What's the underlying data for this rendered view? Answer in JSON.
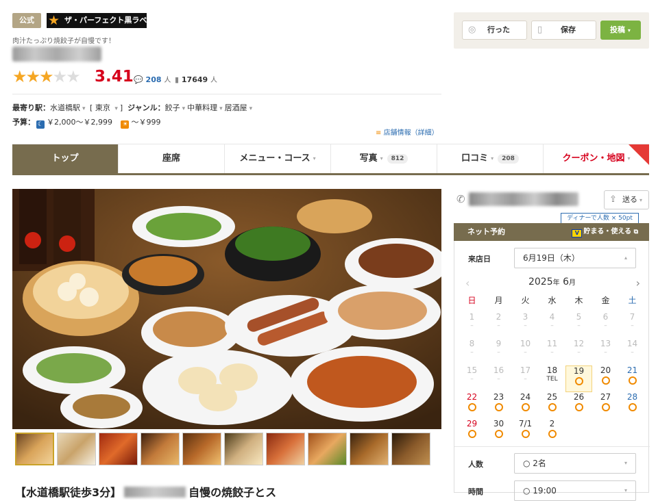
{
  "header": {
    "official_badge": "公式",
    "label_logo": "ザ・パーフェクト黒ラベル",
    "catch_copy": "肉汁たっぷり焼餃子が自慢です！",
    "rating": {
      "stars": 3.41,
      "score": "3.41"
    },
    "reviews": {
      "count": "208",
      "unit": "人"
    },
    "bookmarks": {
      "count": "17649",
      "unit": "人"
    },
    "nearest_station_label": "最寄り駅：",
    "station": "水道橋駅",
    "area": "東京",
    "genre_label": "ジャンル：",
    "genres": [
      "餃子",
      "中華料理",
      "居酒屋"
    ],
    "budget_label": "予算：",
    "budget_dinner": "￥2,000～￥2,999",
    "budget_lunch": "～￥999",
    "shop_info_link": "店舗情報（詳細）"
  },
  "actions": {
    "visited": "行った",
    "save": "保存",
    "post": "投稿"
  },
  "tabs": [
    {
      "label": "トップ",
      "active": true
    },
    {
      "label": "座席"
    },
    {
      "label": "メニュー・コース"
    },
    {
      "label": "写真",
      "count": "812"
    },
    {
      "label": "口コミ",
      "count": "208"
    },
    {
      "label": "クーポン・地図"
    }
  ],
  "right": {
    "send_label": "送る",
    "tpoint_tip": "ディナーで人数 × 50pt",
    "net_reserve": "ネット予約",
    "tpoint_label": "貯まる・使える",
    "visit_date_label": "来店日",
    "visit_date_value": "6月19日（木）",
    "calendar_year": "2025",
    "calendar_year_unit": "年",
    "calendar_month": "6",
    "calendar_month_unit": "月",
    "dow": [
      "日",
      "月",
      "火",
      "水",
      "木",
      "金",
      "土"
    ],
    "weeks": [
      [
        {
          "d": "1",
          "m": "–",
          "past": true
        },
        {
          "d": "2",
          "m": "–",
          "past": true
        },
        {
          "d": "3",
          "m": "–",
          "past": true
        },
        {
          "d": "4",
          "m": "–",
          "past": true
        },
        {
          "d": "5",
          "m": "–",
          "past": true
        },
        {
          "d": "6",
          "m": "–",
          "past": true
        },
        {
          "d": "7",
          "m": "–",
          "past": true
        }
      ],
      [
        {
          "d": "8",
          "m": "–",
          "past": true
        },
        {
          "d": "9",
          "m": "–",
          "past": true
        },
        {
          "d": "10",
          "m": "–",
          "past": true
        },
        {
          "d": "11",
          "m": "–",
          "past": true
        },
        {
          "d": "12",
          "m": "–",
          "past": true
        },
        {
          "d": "13",
          "m": "–",
          "past": true
        },
        {
          "d": "14",
          "m": "–",
          "past": true
        }
      ],
      [
        {
          "d": "15",
          "m": "–",
          "past": true
        },
        {
          "d": "16",
          "m": "–",
          "past": true
        },
        {
          "d": "17",
          "m": "–",
          "past": true
        },
        {
          "d": "18",
          "m": "TEL"
        },
        {
          "d": "19",
          "m": "o",
          "today": true
        },
        {
          "d": "20",
          "m": "o"
        },
        {
          "d": "21",
          "m": "o"
        }
      ],
      [
        {
          "d": "22",
          "m": "o"
        },
        {
          "d": "23",
          "m": "o"
        },
        {
          "d": "24",
          "m": "o"
        },
        {
          "d": "25",
          "m": "o"
        },
        {
          "d": "26",
          "m": "o"
        },
        {
          "d": "27",
          "m": "o"
        },
        {
          "d": "28",
          "m": "o"
        }
      ],
      [
        {
          "d": "29",
          "m": "o"
        },
        {
          "d": "30",
          "m": "o"
        },
        {
          "d": "7/1",
          "m": "o"
        },
        {
          "d": "2",
          "m": "o"
        }
      ]
    ],
    "people_label": "人数",
    "people_value": "2名",
    "time_label": "時間",
    "time_value": "19:00"
  },
  "main": {
    "title_prefix": "【水道橋駅徒歩3分】",
    "title_suffix": "自慢の焼餃子とス"
  },
  "colors": {
    "accent": "#776c4e",
    "score": "#d6001c",
    "post": "#7cb342",
    "ok": "#f08a00"
  }
}
